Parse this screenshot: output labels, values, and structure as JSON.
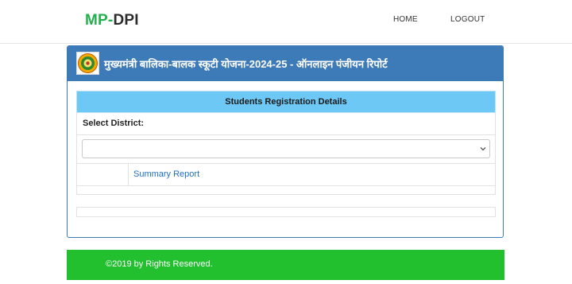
{
  "brand": {
    "part1": "MP-",
    "part2": "DPI"
  },
  "nav": {
    "home": "HOME",
    "logout": "LOGOUT"
  },
  "panel": {
    "title": "मुख्यमंत्री बालिका-बालक स्कूटी योजना-2024-25 - ऑनलाइन पंजीयन रिपोर्ट"
  },
  "table": {
    "heading": "Students Registration Details",
    "select_label": "Select District:",
    "select_value": "",
    "summary_link": "Summary Report"
  },
  "footer": {
    "text": "©2019 by Rights Reserved."
  },
  "colors": {
    "brand_green": "#22b14c",
    "panel_blue": "#3d7ab8",
    "table_head": "#6ec8f5",
    "footer_green": "#22c02f",
    "link": "#1f6fc0"
  }
}
